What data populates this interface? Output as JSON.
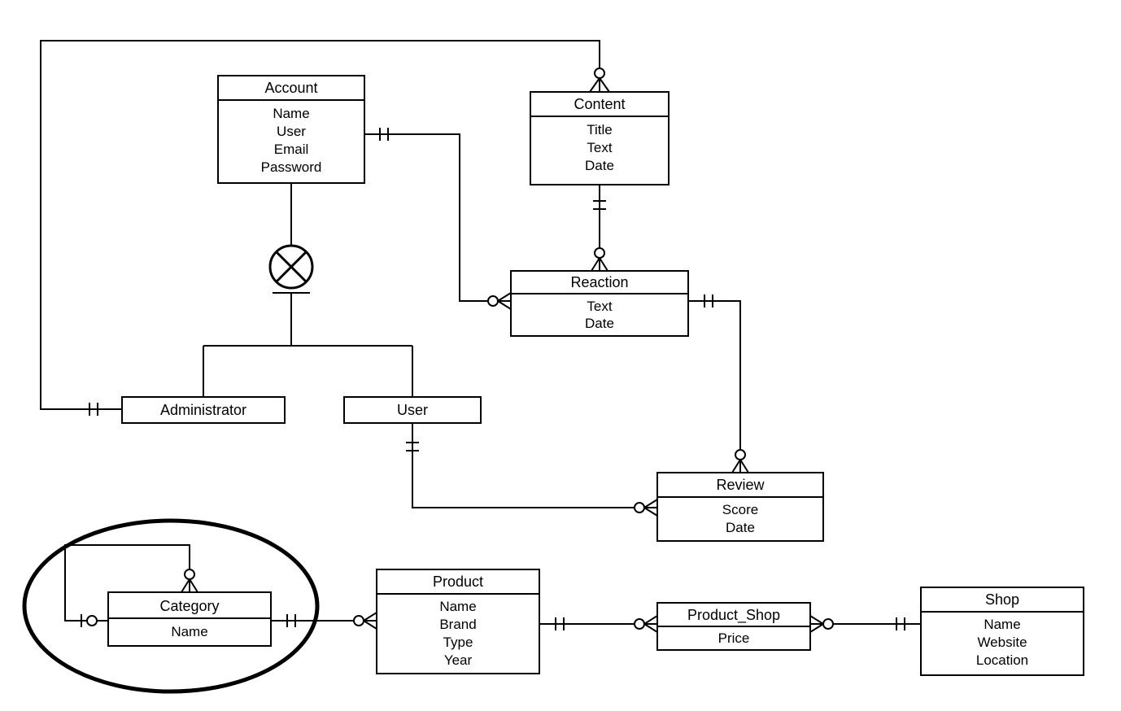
{
  "diagram_type": "Entity-Relationship Diagram (ERD)",
  "entities": {
    "account": {
      "title": "Account",
      "attrs": [
        "Name",
        "User",
        "Email",
        "Password"
      ]
    },
    "content": {
      "title": "Content",
      "attrs": [
        "Title",
        "Text",
        "Date"
      ]
    },
    "reaction": {
      "title": "Reaction",
      "attrs": [
        "Text",
        "Date"
      ]
    },
    "administrator": {
      "title": "Administrator",
      "attrs": []
    },
    "user": {
      "title": "User",
      "attrs": []
    },
    "review": {
      "title": "Review",
      "attrs": [
        "Score",
        "Date"
      ]
    },
    "category": {
      "title": "Category",
      "attrs": [
        "Name"
      ]
    },
    "product": {
      "title": "Product",
      "attrs": [
        "Name",
        "Brand",
        "Type",
        "Year"
      ]
    },
    "product_shop": {
      "title": "Product_Shop",
      "attrs": [
        "Price"
      ]
    },
    "shop": {
      "title": "Shop",
      "attrs": [
        "Name",
        "Website",
        "Location"
      ]
    }
  },
  "inheritance": {
    "parent": "account",
    "children": [
      "administrator",
      "user"
    ],
    "type": "disjoint (circle with X)"
  },
  "relationships": [
    {
      "from": "administrator",
      "to": "content",
      "from_card": "one-and-only-one",
      "to_card": "zero-or-many"
    },
    {
      "from": "account",
      "to": "reaction",
      "from_card": "one-and-only-one",
      "to_card": "zero-or-many"
    },
    {
      "from": "content",
      "to": "reaction",
      "from_card": "one-and-only-one",
      "to_card": "zero-or-many"
    },
    {
      "from": "reaction",
      "to": "review",
      "from_card": "one-and-only-one",
      "to_card": "zero-or-many"
    },
    {
      "from": "user",
      "to": "review",
      "from_card": "one-and-only-one",
      "to_card": "zero-or-many"
    },
    {
      "from": "category",
      "to": "category",
      "from_card": "zero-or-one",
      "to_card": "zero-or-many",
      "note": "self-reference"
    },
    {
      "from": "category",
      "to": "product",
      "from_card": "one-and-only-one",
      "to_card": "zero-or-many"
    },
    {
      "from": "product",
      "to": "product_shop",
      "from_card": "one-and-only-one",
      "to_card": "zero-or-many"
    },
    {
      "from": "shop",
      "to": "product_shop",
      "from_card": "one-and-only-one",
      "to_card": "zero-or-many"
    }
  ],
  "highlight": {
    "entity": "category",
    "shape": "ellipse"
  }
}
